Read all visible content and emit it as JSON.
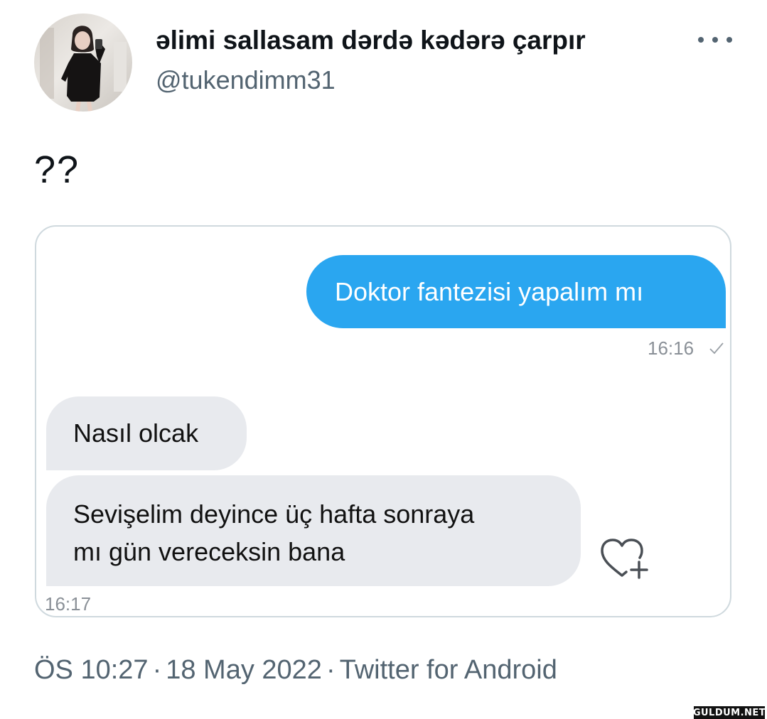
{
  "tweet": {
    "author": {
      "display_name": "əlimi sallasam dərdə kədərə çarpır",
      "handle": "@tukendimm31",
      "avatar_icon": "profile-photo"
    },
    "text": "??",
    "media": {
      "messages": [
        {
          "direction": "outgoing",
          "text": "Doktor fantezisi yapalım mı",
          "time": "16:16"
        },
        {
          "direction": "incoming",
          "text": "Nasıl olcak"
        },
        {
          "direction": "incoming",
          "lines": [
            "Sevişelim deyince üç hafta sonraya",
            "mı gün vereceksin bana"
          ],
          "time": "16:17"
        }
      ],
      "outgoing_bubble_color": "#2aa6f0",
      "incoming_bubble_color": "#e8eaee"
    },
    "meta": {
      "time": "ÖS 10:27",
      "date": "18 May 2022",
      "source": "Twitter for Android",
      "separator": "·"
    }
  },
  "watermark": "GULDUM.NET"
}
